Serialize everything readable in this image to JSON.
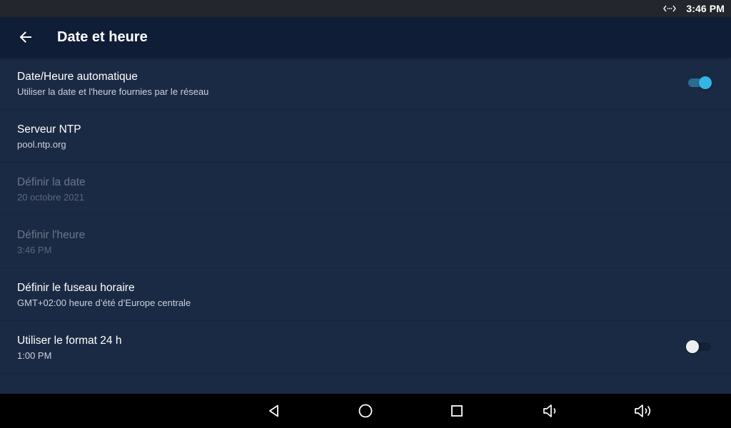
{
  "status_bar": {
    "time": "3:46 PM",
    "icons": [
      "sync-icon"
    ]
  },
  "app_bar": {
    "title": "Date et heure",
    "back_icon": "arrow-back-icon"
  },
  "settings": [
    {
      "title": "Date/Heure automatique",
      "summary": "Utiliser la date et l'heure fournies par le réseau",
      "enabled": true,
      "switch": true,
      "checked": true
    },
    {
      "title": "Serveur NTP",
      "summary": "pool.ntp.org",
      "enabled": true
    },
    {
      "title": "Définir la date",
      "summary": "20 octobre 2021",
      "enabled": false
    },
    {
      "title": "Définir l'heure",
      "summary": "3:46 PM",
      "enabled": false
    },
    {
      "title": "Définir le fuseau horaire",
      "summary": "GMT+02:00 heure d’été d’Europe centrale",
      "enabled": true
    },
    {
      "title": "Utiliser le format 24 h",
      "summary": "1:00 PM",
      "enabled": true,
      "switch": true,
      "checked": false
    }
  ],
  "nav_bar": {
    "icons": [
      "back-triangle-icon",
      "home-circle-icon",
      "recents-square-icon",
      "volume-down-icon",
      "volume-up-icon"
    ]
  },
  "colors": {
    "background": "#1b2a44",
    "app_bar": "#0f1d36",
    "status_bar": "#23272d",
    "accent": "#33b5e5",
    "nav_bar": "#000000"
  }
}
